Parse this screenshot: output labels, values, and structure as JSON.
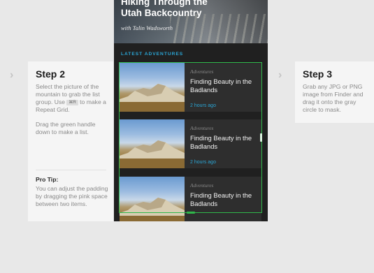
{
  "step2": {
    "title": "Step 2",
    "line1": "Select the picture of the mountain to grab the list group. Use",
    "shortcut": "⌘R",
    "line2": "to make a Repeat Grid.",
    "para2": "Drag the green handle down to make a list.",
    "pro_title": "Pro Tip:",
    "pro_body": "You can adjust the padding by dragging the pink space between two items."
  },
  "step3": {
    "title": "Step 3",
    "body": "Grab any JPG or PNG image from Finder and drag it onto the gray circle to mask."
  },
  "hero": {
    "title": "Hiking Through the Utah Backcountry",
    "author": "with Talin Wadsworth"
  },
  "section_label": "LATEST ADVENTURES",
  "cards": [
    {
      "category": "Adventures",
      "title": "Finding Beauty in the Badlands",
      "time": "2 hours ago"
    },
    {
      "category": "Adventures",
      "title": "Finding Beauty in the Badlands",
      "time": "2 hours ago"
    },
    {
      "category": "Adventures",
      "title": "Finding Beauty in the Badlands"
    }
  ],
  "colors": {
    "accent_blue": "#2aa6d6",
    "grid_green": "#2fb84a",
    "phone_bg": "#202020",
    "card_bg": "#2e2e2e"
  },
  "icons": [
    "chevron-right-icon",
    "chevron-right-icon"
  ]
}
